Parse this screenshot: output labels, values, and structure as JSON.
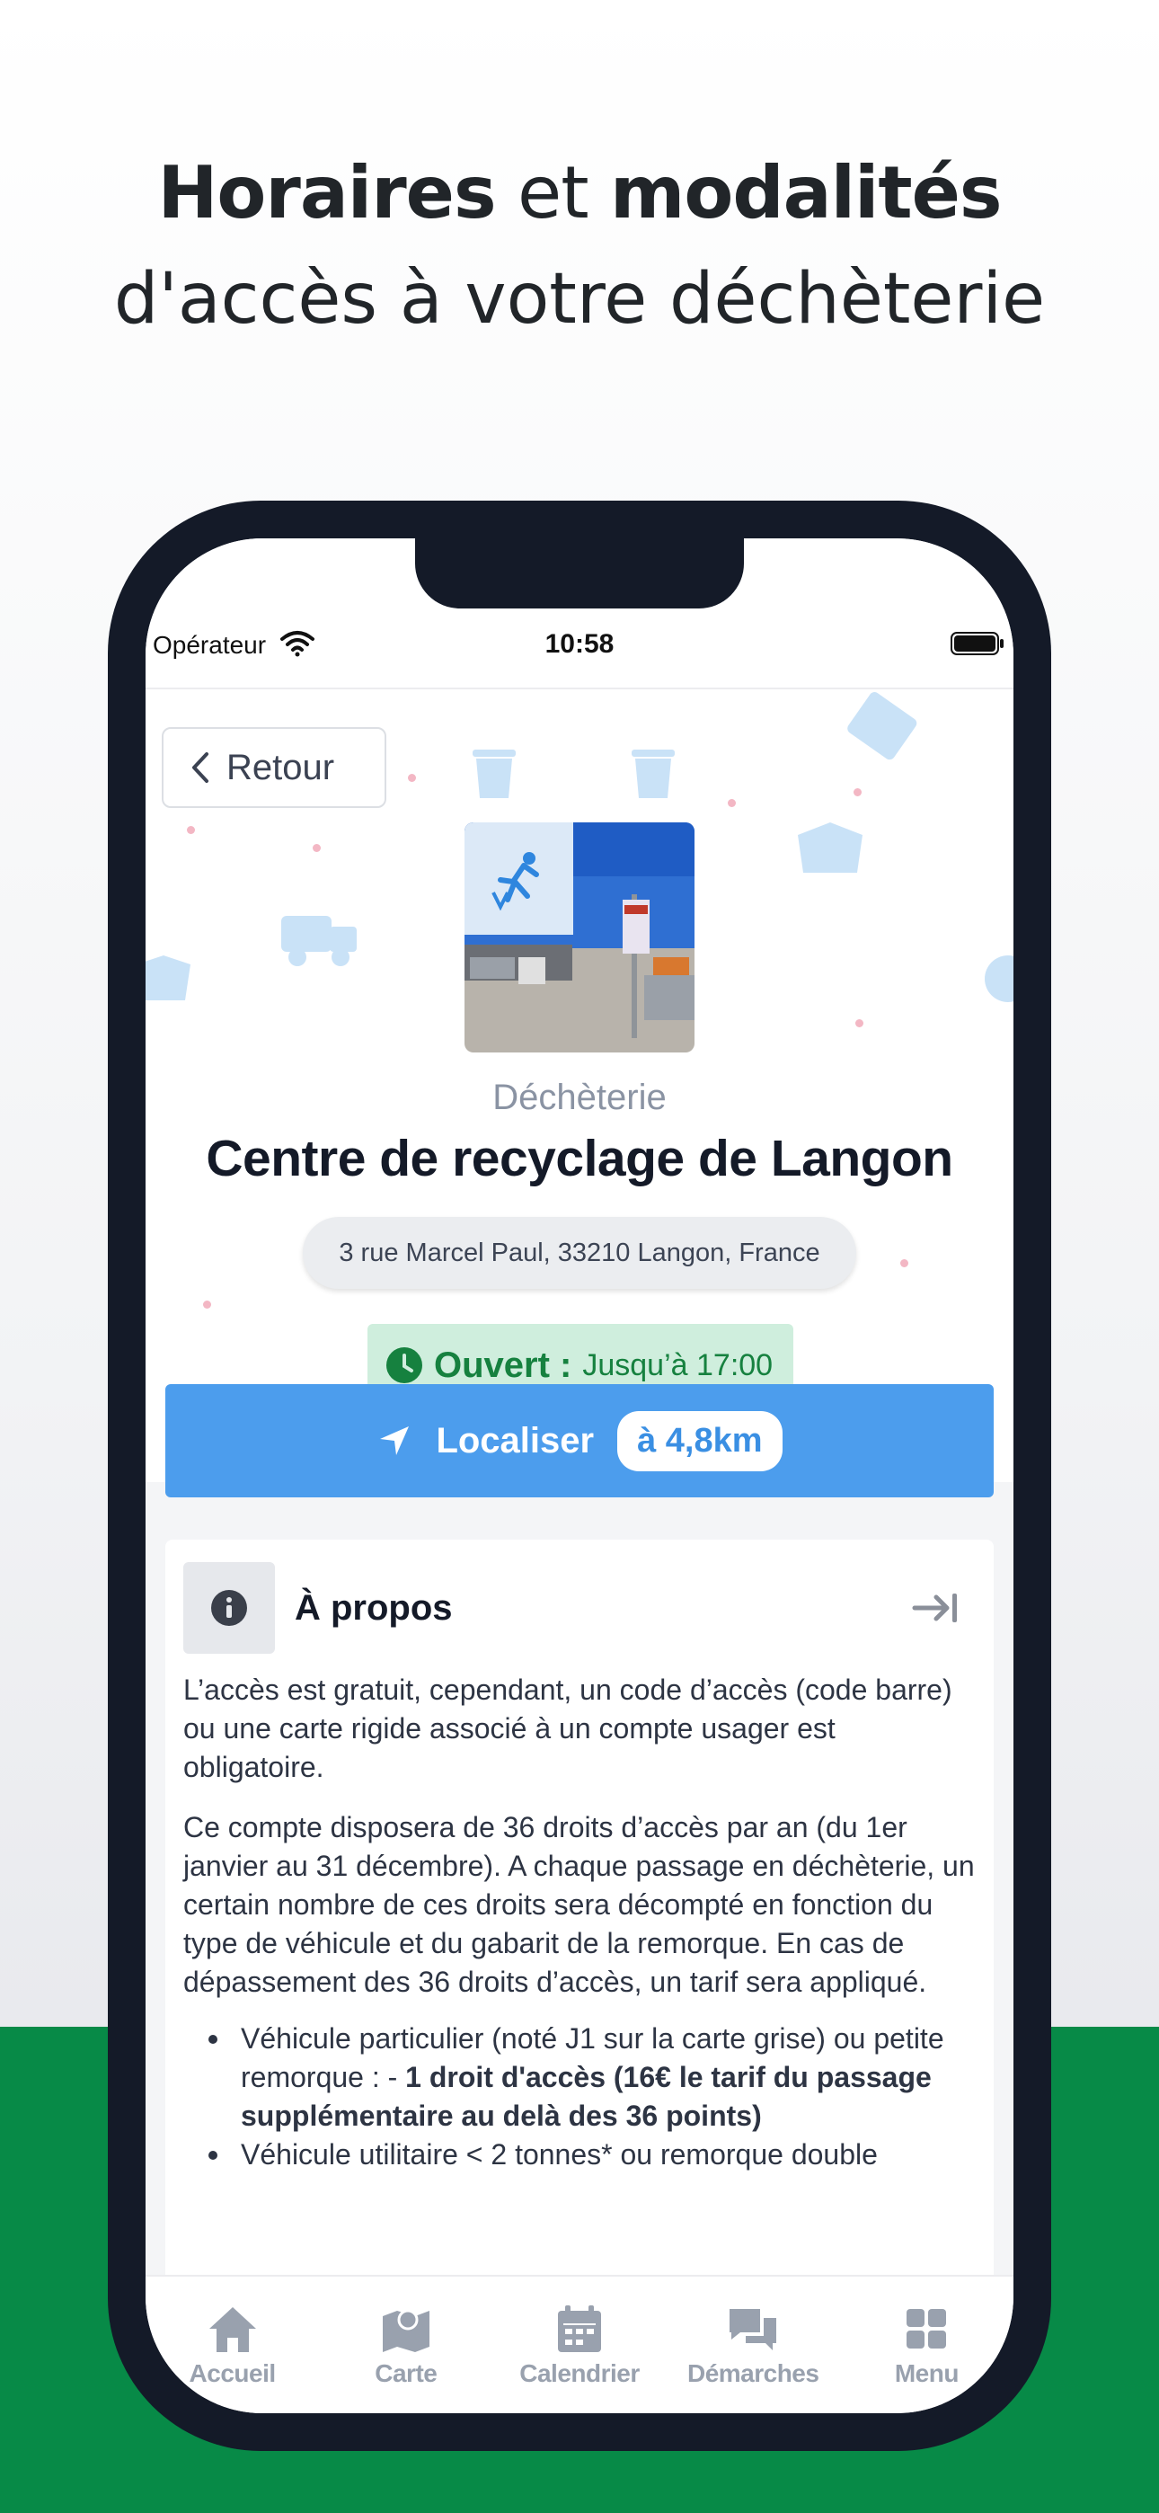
{
  "headline": {
    "bold1": "Horaires",
    "mid": " et ",
    "bold2": "modalités",
    "line2": "d'accès à votre déchèterie"
  },
  "status_bar": {
    "operator": "Opérateur",
    "time": "10:58"
  },
  "header": {
    "back_label": "Retour"
  },
  "facility": {
    "category": "Déchèterie",
    "name": "Centre de recyclage de Langon",
    "address": "3 rue Marcel Paul, 33210 Langon, France",
    "status_open": "Ouvert :",
    "status_until": "Jusqu’à 17:00",
    "status_color": "#16813f"
  },
  "locate": {
    "label": "Localiser",
    "distance": "à 4,8km",
    "color": "#4c9ded"
  },
  "about": {
    "title": "À propos",
    "paragraph1": "L’accès est gratuit, cependant, un code d’accès (code barre) ou une carte rigide associé à un compte usager est obligatoire.",
    "paragraph2": "Ce compte disposera de 36 droits d’accès par an (du 1er janvier au 31 décembre). A chaque passage en déchèterie, un certain nombre de ces droits sera décompté en fonction du type de véhicule et du gabarit de la remorque. En cas de dépassement des 36 droits d’accès, un tarif sera appliqué.",
    "bullet1_text": "Véhicule particulier (noté J1 sur la carte grise) ou petite remorque : - ",
    "bullet1_bold": "1 droit d'accès (16€ le tarif du passage supplémentaire au delà des 36 points)",
    "bullet2_text": "Véhicule utilitaire < 2 tonnes* ou remorque double"
  },
  "tabs": [
    {
      "label": "Accueil",
      "icon": "home-icon"
    },
    {
      "label": "Carte",
      "icon": "map-icon"
    },
    {
      "label": "Calendrier",
      "icon": "calendar-icon"
    },
    {
      "label": "Démarches",
      "icon": "chat-icon"
    },
    {
      "label": "Menu",
      "icon": "grid-icon"
    }
  ],
  "colors": {
    "background_band": "#078a47",
    "phone_frame": "#141a28",
    "tab_inactive": "#99a1ae"
  }
}
